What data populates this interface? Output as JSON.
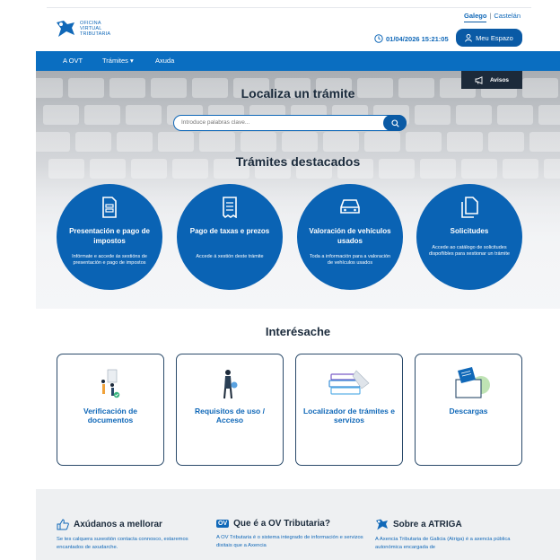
{
  "language": {
    "active": "Galego",
    "other": "Castelán"
  },
  "logo": {
    "line1": "OFICINA",
    "line2": "VIRTUAL",
    "line3": "TRIBUTARIA"
  },
  "header": {
    "datetime": "01/04/2026 15:21:05",
    "user_button": "Meu Espazo"
  },
  "nav": {
    "items": [
      "A OVT",
      "Trámites",
      "Axuda"
    ]
  },
  "avisos": {
    "label": "Avisos"
  },
  "hero": {
    "title": "Localiza un trámite",
    "search_placeholder": "Introduce palabras clave..."
  },
  "featured": {
    "title": "Trámites destacados",
    "items": [
      {
        "title": "Presentación e pago de impostos",
        "description": "Infórmate e accede ás sestións de presentación e pago de impostos",
        "icon": "document-form-icon"
      },
      {
        "title": "Pago de taxas e prezos",
        "description": "Accede á xestión deste trámite",
        "icon": "receipt-icon"
      },
      {
        "title": "Valoración de vehículos usados",
        "description": "Toda a información para a valoración de vehículos usados",
        "icon": "car-icon"
      },
      {
        "title": "Solicitudes",
        "description": "Accede ao catálogo de solicitudes dispoñibles para xestionar un trámite",
        "icon": "documents-icon"
      }
    ]
  },
  "interest": {
    "title": "Interésache",
    "items": [
      {
        "label": "Verificación de documentos",
        "icon": "verification-illustration-icon"
      },
      {
        "label": "Requisitos de uso / Acceso",
        "icon": "person-requirements-icon"
      },
      {
        "label": "Localizador de trámites e servizos",
        "icon": "books-illustration-icon"
      },
      {
        "label": "Descargas",
        "icon": "downloads-illustration-icon"
      }
    ]
  },
  "footer": {
    "cols": [
      {
        "title": "Axúdanos a mellorar",
        "text": "Se tes calquera suxestión contacta connosco, estaremos encantados de axudarche.",
        "icon": "thumbs-up-icon"
      },
      {
        "title": "Que é a OV Tributaria?",
        "badge": "OV",
        "text": "A OV Tributaria é o sistema integrado de información e servizos dixitais que a Axencia",
        "icon": "ov-badge-icon"
      },
      {
        "title": "Sobre a ATRIGA",
        "text": "A Axencia Tributaria de Galicia (Atriga) é a axencia pública autonómica encargada de",
        "icon": "atriga-logo-icon"
      }
    ]
  },
  "colors": {
    "primary": "#0a63b4",
    "nav": "#0a6ec1",
    "dark": "#1c2a3a"
  }
}
